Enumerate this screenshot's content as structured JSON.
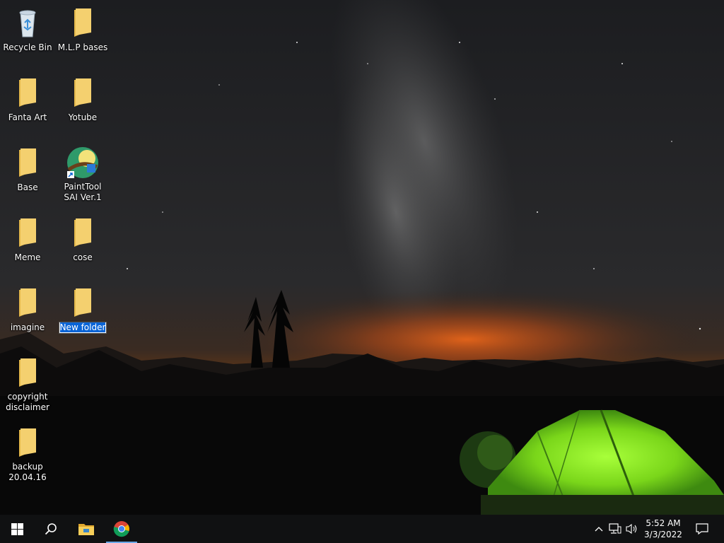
{
  "desktop": {
    "icons": [
      {
        "label": "Recycle Bin",
        "icon": "recycle-bin-icon"
      },
      {
        "label": "M.L.P bases",
        "icon": "folder-icon"
      },
      {
        "label": "Fanta Art",
        "icon": "folder-icon"
      },
      {
        "label": "Yotube",
        "icon": "folder-icon"
      },
      {
        "label": "Base",
        "icon": "folder-icon"
      },
      {
        "label": "PaintTool SAI Ver.1",
        "icon": "painttool-sai-shortcut-icon"
      },
      {
        "label": "Meme",
        "icon": "folder-icon"
      },
      {
        "label": "cose",
        "icon": "folder-icon"
      },
      {
        "label": "imagine",
        "icon": "folder-icon"
      },
      {
        "label": "New folder",
        "icon": "folder-icon",
        "state": "renaming"
      },
      {
        "label": "copyright disclaimer",
        "icon": "folder-icon"
      },
      {
        "label": "backup 20.04.16",
        "icon": "folder-icon"
      }
    ]
  },
  "taskbar": {
    "start": {
      "icon": "windows-start-icon"
    },
    "search": {
      "icon": "search-icon"
    },
    "pinned": [
      {
        "icon": "file-explorer-icon"
      },
      {
        "icon": "chrome-icon",
        "active": true
      }
    ],
    "tray": {
      "icons": [
        "chevron-up-icon",
        "network-icon",
        "volume-icon"
      ],
      "time": "5:52 AM",
      "date": "3/3/2022",
      "notification_icon": "action-center-icon"
    }
  },
  "colors": {
    "taskbar_bg": "#101112",
    "folder_yellow": "#f4d06f",
    "selection_blue": "#0a64d6",
    "active_indicator": "#6aa8e8"
  }
}
